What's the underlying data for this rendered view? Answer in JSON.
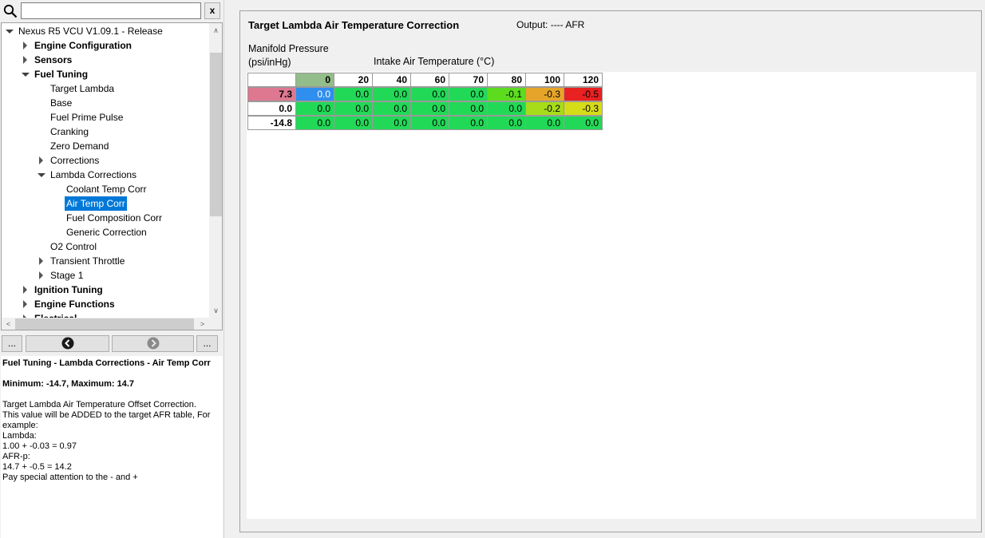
{
  "search": {
    "value": "",
    "clear_label": "x"
  },
  "tree": {
    "items": [
      {
        "label": "Nexus R5 VCU V1.09.1 - Release",
        "level": 0,
        "expanded": true,
        "bold": false
      },
      {
        "label": "Engine Configuration",
        "level": 1,
        "expanded": false,
        "bold": true
      },
      {
        "label": "Sensors",
        "level": 1,
        "expanded": false,
        "bold": true
      },
      {
        "label": "Fuel Tuning",
        "level": 1,
        "expanded": true,
        "bold": true
      },
      {
        "label": "Target Lambda",
        "level": 2
      },
      {
        "label": "Base",
        "level": 2
      },
      {
        "label": "Fuel Prime Pulse",
        "level": 2
      },
      {
        "label": "Cranking",
        "level": 2
      },
      {
        "label": "Zero Demand",
        "level": 2
      },
      {
        "label": "Corrections",
        "level": 2,
        "expanded": false
      },
      {
        "label": "Lambda Corrections",
        "level": 2,
        "expanded": true
      },
      {
        "label": "Coolant Temp Corr",
        "level": 3
      },
      {
        "label": "Air Temp Corr",
        "level": 3,
        "selected": true
      },
      {
        "label": "Fuel Composition Corr",
        "level": 3
      },
      {
        "label": "Generic Correction",
        "level": 3
      },
      {
        "label": "O2 Control",
        "level": 2
      },
      {
        "label": "Transient Throttle",
        "level": 2,
        "expanded": false
      },
      {
        "label": "Stage 1",
        "level": 2,
        "expanded": false
      },
      {
        "label": "Ignition Tuning",
        "level": 1,
        "expanded": false,
        "bold": true
      },
      {
        "label": "Engine Functions",
        "level": 1,
        "expanded": false,
        "bold": true
      },
      {
        "label": "Electrical",
        "level": 1,
        "expanded": false,
        "bold": true
      }
    ]
  },
  "nav": {
    "more_left": "...",
    "more_right": "...",
    "back_icon": "circle-left-arrow-icon",
    "forward_icon": "circle-right-arrow-icon"
  },
  "help": {
    "title": "Fuel Tuning - Lambda Corrections - Air Temp Corr",
    "range": "Minimum: -14.7, Maximum: 14.7",
    "lines": [
      "Target Lambda Air Temperature Offset Correction.",
      "This value will be ADDED to the target AFR table, For",
      "example:",
      "Lambda:",
      "1.00 + -0.03 = 0.97",
      "AFR-p:",
      "14.7 + -0.5 = 14.2",
      "Pay special attention to the - and +"
    ]
  },
  "editor": {
    "title": "Target Lambda Air Temperature Correction",
    "output": "Output: ---- AFR",
    "y_label_1": "Manifold Pressure",
    "y_label_2": "(psi/inHg)",
    "x_label": "Intake Air Temperature (°C)",
    "columns": [
      "0",
      "20",
      "40",
      "60",
      "70",
      "80",
      "100",
      "120"
    ],
    "rows": [
      {
        "label": "7.3",
        "values": [
          "0.0",
          "0.0",
          "0.0",
          "0.0",
          "0.0",
          "-0.1",
          "-0.3",
          "-0.5"
        ]
      },
      {
        "label": "0.0",
        "values": [
          "0.0",
          "0.0",
          "0.0",
          "0.0",
          "0.0",
          "0.0",
          "-0.2",
          "-0.3"
        ]
      },
      {
        "label": "-14.8",
        "values": [
          "0.0",
          "0.0",
          "0.0",
          "0.0",
          "0.0",
          "0.0",
          "0.0",
          "0.0"
        ]
      }
    ],
    "colors": {
      "zero": "#22d957",
      "minus01": "#5ddc1f",
      "minus02": "#a6dc19",
      "minus03_light": "#d6dc17",
      "minus03": "#e6a52a",
      "minus05": "#e82121",
      "selected_cell": "#2f8eee",
      "active_row_header": "#dd7890",
      "active_col_header": "#93bd8a"
    }
  }
}
